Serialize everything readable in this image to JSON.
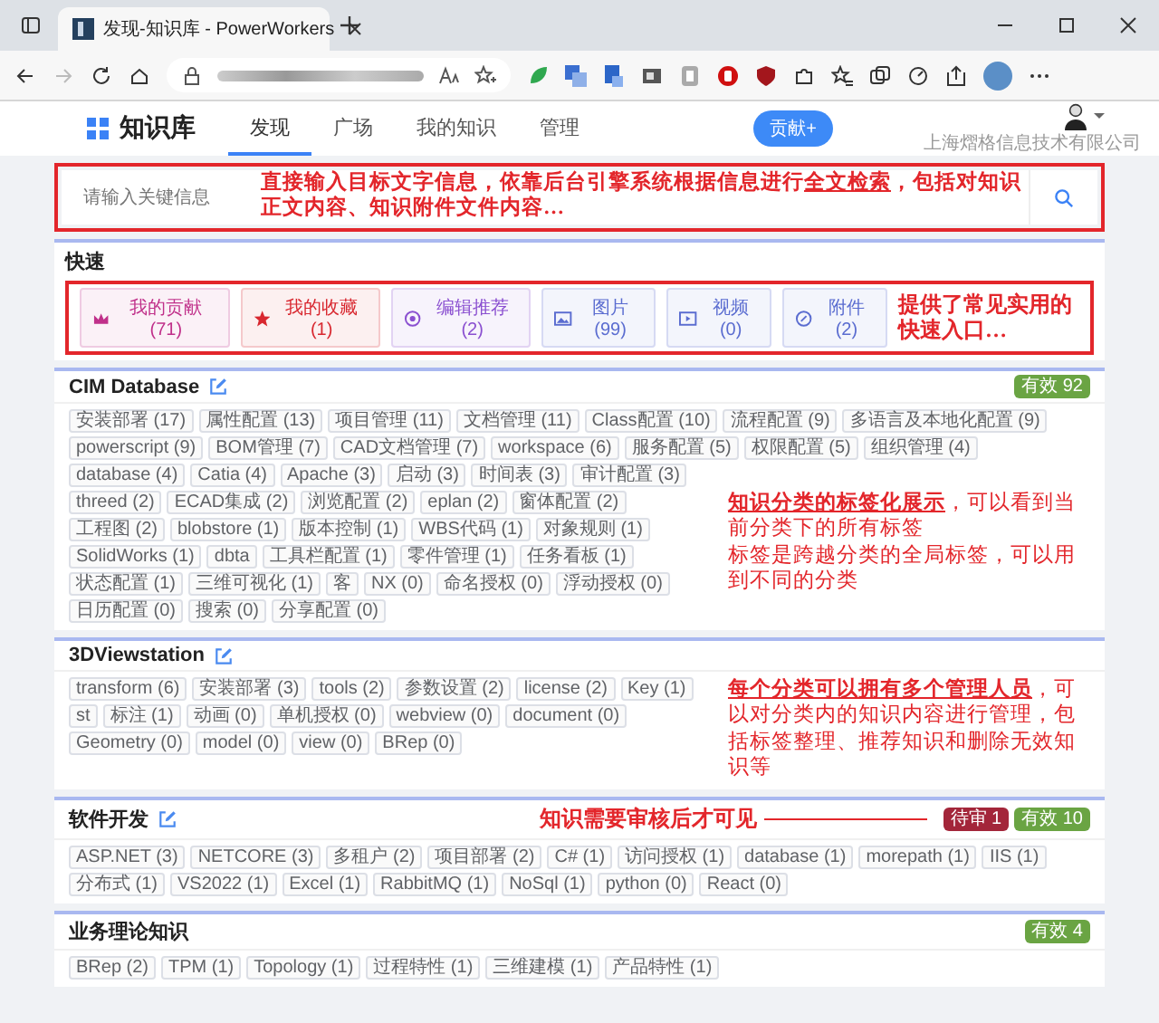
{
  "browser": {
    "tab_title": "发现-知识库 - PowerWorkers"
  },
  "app": {
    "title": "知识库",
    "nav": [
      {
        "label": "发现",
        "selected": true
      },
      {
        "label": "广场",
        "selected": false
      },
      {
        "label": "我的知识",
        "selected": false
      },
      {
        "label": "管理",
        "selected": false
      }
    ],
    "contribute_button": "贡献+",
    "company": "上海熠格信息技术有限公司"
  },
  "search": {
    "placeholder": "请输入关键信息",
    "annotation": "直接输入目标文字信息，依靠后台引擎系统根据信息进行**全文检索**，包括对知识正文内容、知识附件文件内容…"
  },
  "quick": {
    "title": "快速",
    "annotation": "提供了常见实用的快速入口…",
    "buttons": [
      {
        "kind": "crown",
        "label": "我的贡献(71)",
        "color": "#c0308a"
      },
      {
        "kind": "star",
        "label": "我的收藏(1)",
        "color": "#d8272f"
      },
      {
        "kind": "recommend",
        "label": "编辑推荐(2)",
        "color": "#8a4fd0"
      },
      {
        "kind": "image",
        "label": "图片(99)",
        "color": "#5a6cd0"
      },
      {
        "kind": "video",
        "label": "视频(0)",
        "color": "#5a6cd0"
      },
      {
        "kind": "attachment",
        "label": "附件(2)",
        "color": "#5a6cd0"
      }
    ]
  },
  "categories": [
    {
      "title": "CIM Database",
      "editable": true,
      "badges": [
        {
          "kind": "valid",
          "label": "有效 92"
        }
      ],
      "tags": [
        "安装部署 (17)",
        "属性配置 (13)",
        "项目管理 (11)",
        "文档管理 (11)",
        "Class配置 (10)",
        "流程配置 (9)",
        "多语言及本地化配置 (9)",
        "powerscript (9)",
        "BOM管理 (7)",
        "CAD文档管理 (7)",
        "workspace (6)",
        "服务配置 (5)",
        "权限配置 (5)",
        "组织管理 (4)",
        "database (4)",
        "Catia (4)",
        "Apache (3)",
        "启动 (3)",
        "时间表 (3)",
        "审计配置 (3)"
      ],
      "tags_beside_note": [
        "threed (2)",
        "ECAD集成 (2)",
        "浏览配置 (2)",
        "eplan (2)",
        "窗体配置 (2)",
        "工程图 (2)",
        "blobstore (1)",
        "版本控制 (1)",
        "WBS代码 (1)",
        "对象规则 (1)",
        "SolidWorks (1)",
        "dbta",
        "工具栏配置 (1)",
        "零件管理 (1)",
        "任务看板 (1)",
        "状态配置 (1)",
        "三维可视化 (1)",
        "客",
        "NX (0)",
        "命名授权 (0)",
        "浮动授权 (0)",
        "日历配置 (0)",
        "搜索 (0)",
        "分享配置 (0)"
      ],
      "note": [
        "**知识分类的标签化展示**，可以看到当前分类下的所有标签",
        "标签是跨越分类的全局标签，可以用到不同的分类"
      ]
    },
    {
      "title": "3DViewstation",
      "editable": true,
      "tags_beside_note": [
        "transform (6)",
        "安装部署 (3)",
        "tools (2)",
        "参数设置 (2)",
        "license (2)",
        "Key (1)",
        "st",
        "标注 (1)",
        "动画 (0)",
        "单机授权 (0)",
        "webview (0)",
        "document (0)",
        "Geometry (0)",
        "model (0)",
        "view (0)",
        "BRep (0)"
      ],
      "note": [
        "**每个分类可以拥有多个管理人员**，可以对分类内的知识内容进行管理，包括标签整理、推荐知识和删除无效知识等"
      ]
    },
    {
      "title": "软件开发",
      "editable": true,
      "annotation": "知识需要审核后才可见",
      "badges": [
        {
          "kind": "pending",
          "label": "待审 1"
        },
        {
          "kind": "valid",
          "label": "有效 10"
        }
      ],
      "tags": [
        "ASP.NET (3)",
        "NETCORE (3)",
        "多租户 (2)",
        "项目部署 (2)",
        "C# (1)",
        "访问授权 (1)",
        "database (1)",
        "morepath (1)",
        "IIS (1)",
        "分布式 (1)",
        "VS2022 (1)",
        "Excel (1)",
        "RabbitMQ (1)",
        "NoSql (1)",
        "python (0)",
        "React (0)"
      ]
    },
    {
      "title": "业务理论知识",
      "editable": false,
      "badges": [
        {
          "kind": "valid",
          "label": "有效 4"
        }
      ],
      "tags": [
        "BRep (2)",
        "TPM (1)",
        "Topology (1)",
        "过程特性 (1)",
        "三维建模 (1)",
        "产品特性 (1)"
      ]
    }
  ]
}
